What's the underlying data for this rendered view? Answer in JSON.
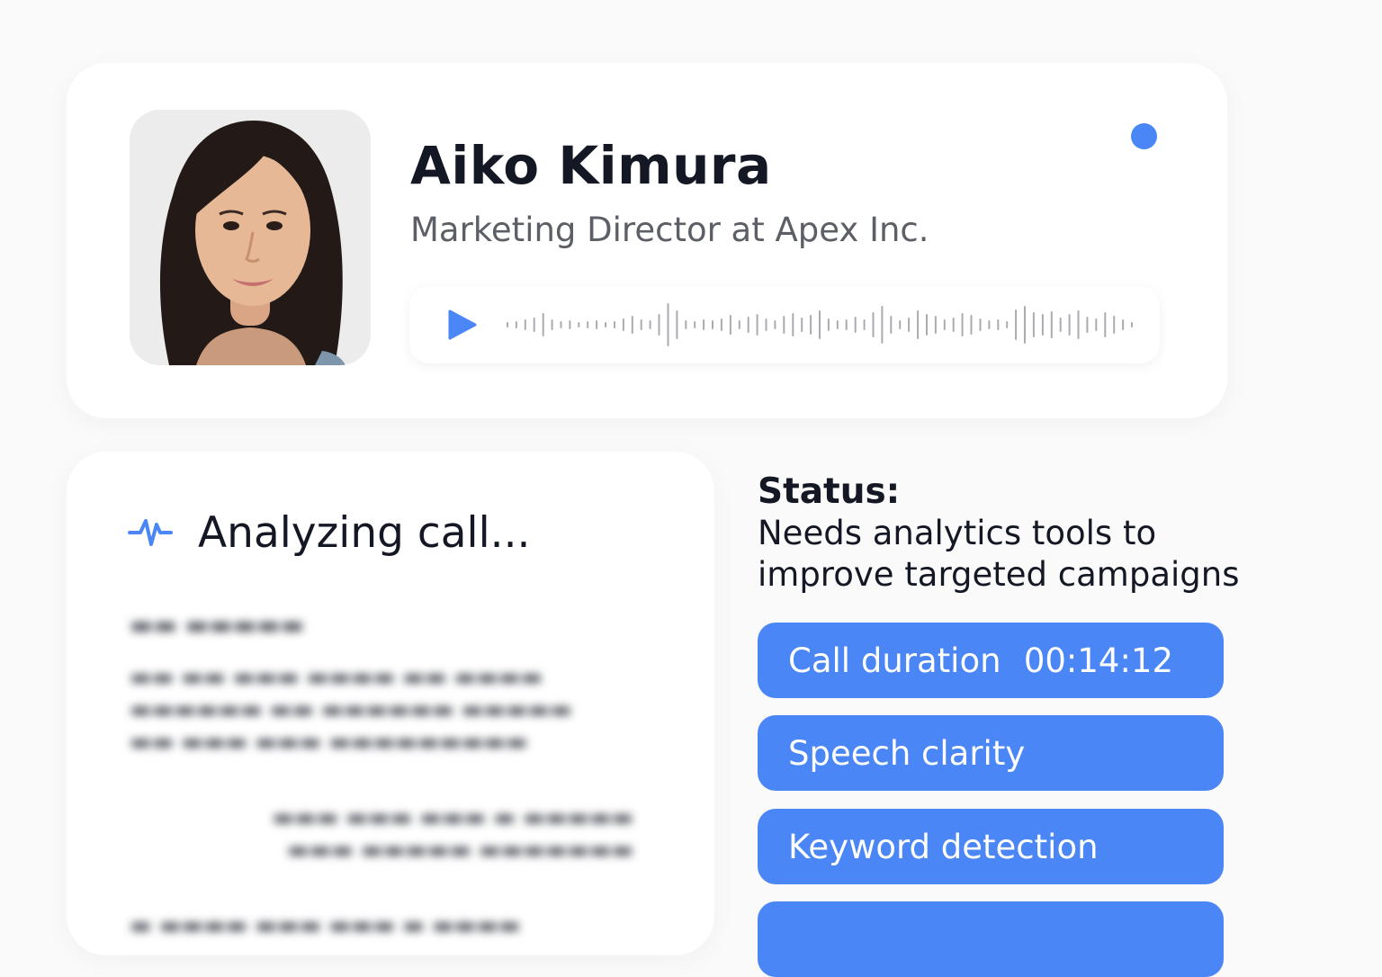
{
  "profile": {
    "name": "Aiko Kimura",
    "role": "Marketing Director at Apex Inc.",
    "presence_color": "#4a86f5",
    "avatar_alt": "Portrait photo"
  },
  "player": {
    "play_icon": "play-icon",
    "waveform_icon": "waveform"
  },
  "analysis": {
    "icon": "pulse-icon",
    "title": "Analyzing call..."
  },
  "status": {
    "label": "Status:",
    "text": "Needs analytics tools to improve targeted campaigns"
  },
  "metrics": [
    {
      "label": "Call duration",
      "value": "00:14:12"
    },
    {
      "label": "Speech clarity"
    },
    {
      "label": "Keyword detection"
    }
  ],
  "colors": {
    "accent": "#4a86f5",
    "card": "#ffffff",
    "background": "#fafafa"
  }
}
